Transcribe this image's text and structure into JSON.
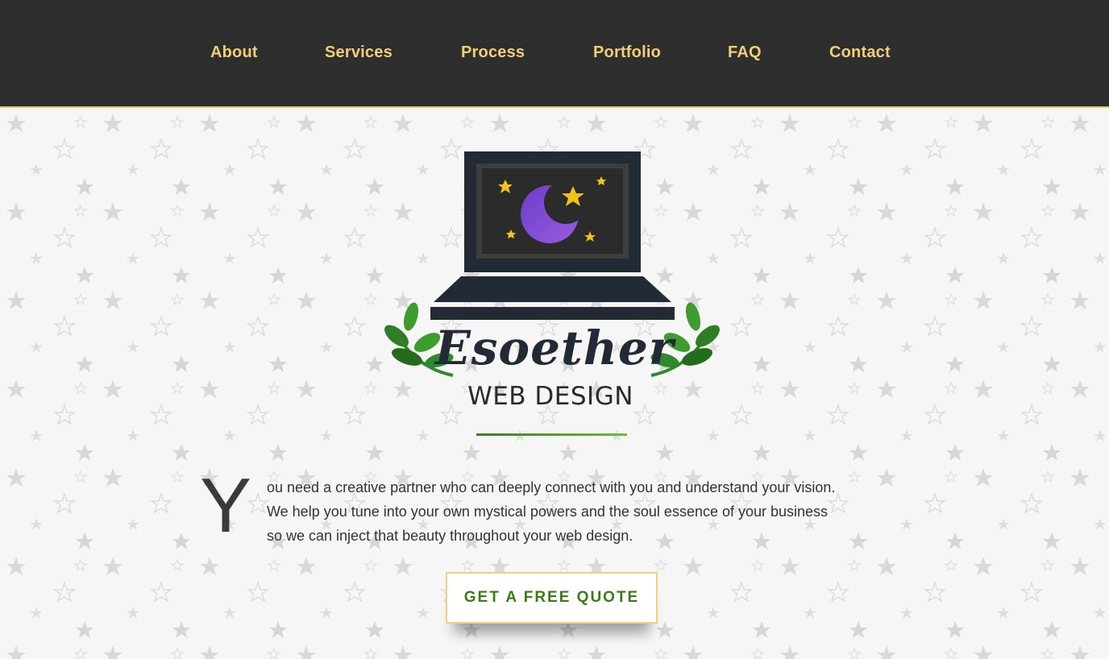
{
  "nav": {
    "items": [
      "About",
      "Services",
      "Process",
      "Portfolio",
      "FAQ",
      "Contact"
    ]
  },
  "brand": {
    "name": "Esoether",
    "subtitle": "WEB DESIGN"
  },
  "intro": {
    "dropcap": "Y",
    "lines": [
      "ou need a creative partner who can deeply connect with you and understand your vision.",
      "We help you tune into your own mystical powers and the soul essence of your business",
      "so we can inject that beauty throughout your web design."
    ]
  },
  "cta": {
    "label": "GET A FREE QUOTE"
  },
  "colors": {
    "nav_bg": "#2e2e2e",
    "nav_text": "#f0cf78",
    "accent_green": "#3d7a18",
    "cta_border": "#f0d27a",
    "moon_purple": "#7b3fd0",
    "star_yellow": "#f2c21b"
  },
  "icons": [
    "laptop-icon",
    "crescent-moon-icon",
    "star-icon",
    "laurel-branch-icon"
  ]
}
